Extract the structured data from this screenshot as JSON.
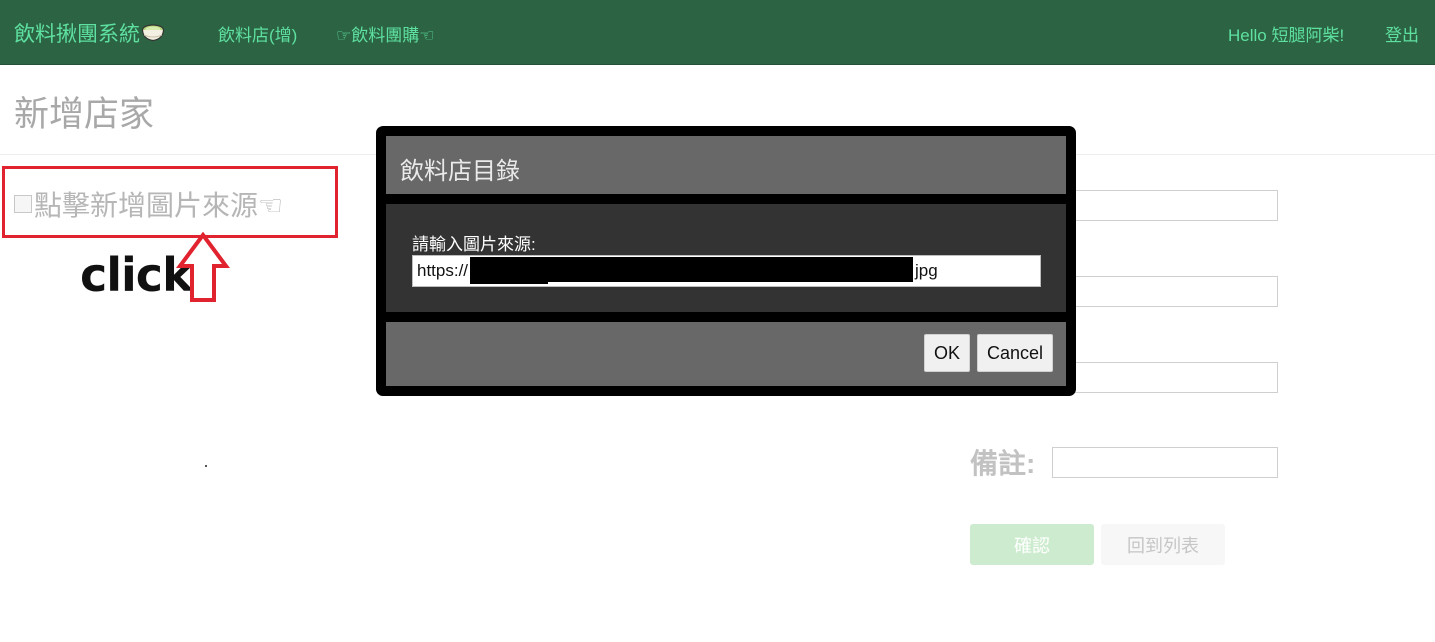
{
  "navbar": {
    "brand": "飲料揪團系統",
    "brand_icon": "drink-cup-icon",
    "links": [
      "飲料店(增)",
      "☞飲料團購☜"
    ],
    "greeting": "Hello 短腿阿柴!",
    "logout": "登出"
  },
  "page": {
    "title": "新增店家",
    "image_placeholder": "點擊新增圖片來源☜",
    "annotation": "click",
    "note_label": "備註:",
    "confirm_button": "確認",
    "back_button": "回到列表"
  },
  "modal": {
    "title": "飲料店目錄",
    "prompt_label": "請輸入圖片來源:",
    "url_prefix": "https://",
    "url_suffix": "jpg",
    "ok_button": "OK",
    "cancel_button": "Cancel"
  },
  "colors": {
    "navbar_bg": "#2c6443",
    "nav_link": "#5ee0a0",
    "highlight": "#e0232e",
    "modal_panel": "#686868",
    "modal_body": "#333333"
  }
}
